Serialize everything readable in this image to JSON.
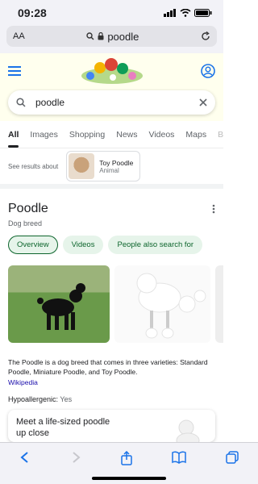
{
  "status": {
    "time": "09:28"
  },
  "safari": {
    "aa_label": "AA",
    "url": "poodle"
  },
  "search": {
    "query": "poodle"
  },
  "tabs": [
    "All",
    "Images",
    "Shopping",
    "News",
    "Videos",
    "Maps",
    "B"
  ],
  "see_results": {
    "label": "See results about",
    "entity_name": "Toy Poodle",
    "entity_type": "Animal"
  },
  "knowledge_panel": {
    "title": "Poodle",
    "subtitle": "Dog breed",
    "pills": [
      "Overview",
      "Videos",
      "People also search for"
    ],
    "description": "The Poodle is a dog breed that comes in three varieties: Standard Poodle, Miniature Poodle, and Toy Poodle.",
    "source_link": "Wikipedia",
    "hypo_label": "Hypoallergenic:",
    "hypo_value": "Yes",
    "card_text": "Meet a life-sized poodle up close"
  },
  "colors": {
    "accent": "#1a73e8",
    "pill_bg": "#e6f4ea",
    "pill_text": "#0d652d",
    "link": "#1a0dab"
  }
}
